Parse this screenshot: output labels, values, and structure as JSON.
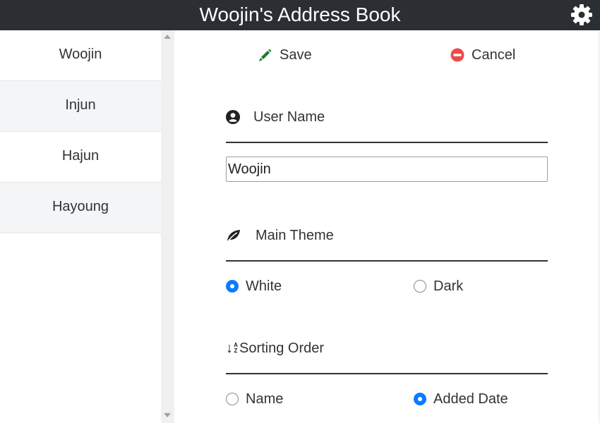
{
  "header": {
    "title": "Woojin's Address Book",
    "settings_icon": "gear-icon"
  },
  "sidebar": {
    "items": [
      {
        "label": "Woojin"
      },
      {
        "label": "Injun"
      },
      {
        "label": "Hajun"
      },
      {
        "label": "Hayoung"
      }
    ]
  },
  "toolbar": {
    "save_label": "Save",
    "save_icon": "pencil-icon",
    "save_icon_color": "#1f7a28",
    "cancel_label": "Cancel",
    "cancel_icon": "minus-circle-icon",
    "cancel_icon_color": "#ef4a4a"
  },
  "form": {
    "user_name": {
      "label": "User Name",
      "icon": "user-circle-icon",
      "value": "Woojin"
    },
    "main_theme": {
      "label": "Main Theme",
      "icon": "leaf-icon",
      "options": [
        {
          "label": "White",
          "checked": true
        },
        {
          "label": "Dark",
          "checked": false
        }
      ]
    },
    "sorting_order": {
      "label": "Sorting Order",
      "icon": "sort-alpha-down-icon",
      "icon_text": "A Z",
      "options": [
        {
          "label": "Name",
          "checked": false
        },
        {
          "label": "Added Date",
          "checked": true
        }
      ]
    }
  },
  "colors": {
    "header_bg": "#2b2e33",
    "accent": "#0a7cff",
    "row_alt": "#f4f5f7"
  }
}
